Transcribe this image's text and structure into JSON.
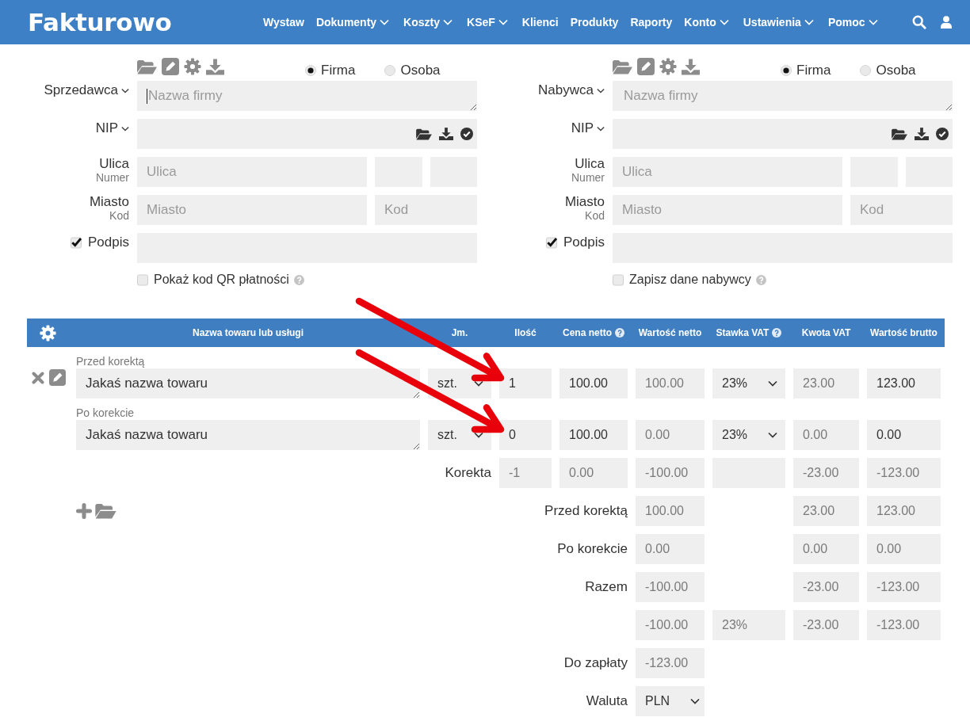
{
  "navbar": {
    "logo": "Fakturowo",
    "menu": [
      {
        "label": "Wystaw",
        "dropdown": false
      },
      {
        "label": "Dokumenty",
        "dropdown": true
      },
      {
        "label": "Koszty",
        "dropdown": true
      },
      {
        "label": "KSeF",
        "dropdown": true
      },
      {
        "label": "Klienci",
        "dropdown": false
      },
      {
        "label": "Produkty",
        "dropdown": false
      },
      {
        "label": "Raporty",
        "dropdown": false
      },
      {
        "label": "Konto",
        "dropdown": true
      },
      {
        "label": "Ustawienia",
        "dropdown": true
      },
      {
        "label": "Pomoc",
        "dropdown": true
      }
    ]
  },
  "parties": [
    {
      "label": "Sprzedawca",
      "entity_types": [
        {
          "label": "Firma",
          "selected": true
        },
        {
          "label": "Osoba",
          "selected": false
        }
      ],
      "name": {
        "placeholder": "Nazwa firmy",
        "focused": true
      },
      "nip_label": "NIP",
      "street": {
        "label": "Ulica",
        "sublabel": "Numer",
        "placeholder": "Ulica"
      },
      "city": {
        "label": "Miasto",
        "sublabel": "Kod",
        "placeholder": "Miasto",
        "code_placeholder": "Kod"
      },
      "signature": {
        "label": "Podpis",
        "checked": true
      },
      "option": {
        "label": "Pokaż kod QR płatności",
        "checked": false,
        "help": true
      }
    },
    {
      "label": "Nabywca",
      "entity_types": [
        {
          "label": "Firma",
          "selected": true
        },
        {
          "label": "Osoba",
          "selected": false
        }
      ],
      "name": {
        "placeholder": "Nazwa firmy",
        "focused": false
      },
      "nip_label": "NIP",
      "street": {
        "label": "Ulica",
        "sublabel": "Numer",
        "placeholder": "Ulica"
      },
      "city": {
        "label": "Miasto",
        "sublabel": "Kod",
        "placeholder": "Miasto",
        "code_placeholder": "Kod"
      },
      "signature": {
        "label": "Podpis",
        "checked": true
      },
      "option": {
        "label": "Zapisz dane nabywcy",
        "checked": false,
        "help": true
      }
    }
  ],
  "items_table": {
    "columns": [
      {
        "label": "Nazwa towaru lub usługi",
        "help": false
      },
      {
        "label": "Jm.",
        "help": false
      },
      {
        "label": "Ilość",
        "help": false
      },
      {
        "label": "Cena netto",
        "help": true
      },
      {
        "label": "Wartość netto",
        "help": false
      },
      {
        "label": "Stawka VAT",
        "help": true
      },
      {
        "label": "Kwota VAT",
        "help": false
      },
      {
        "label": "Wartość brutto",
        "help": false
      }
    ],
    "items": [
      {
        "rows": [
          {
            "kind": "line",
            "caption": "Przed korektą",
            "name": "Jakaś nazwa towaru",
            "cells": [
              {
                "kind": "select",
                "value": "szt."
              },
              {
                "kind": "input",
                "value": "1"
              },
              {
                "kind": "input",
                "value": "100.00"
              },
              {
                "kind": "readonly",
                "value": "100.00"
              },
              {
                "kind": "select",
                "value": "23%"
              },
              {
                "kind": "readonly",
                "value": "23.00"
              },
              {
                "kind": "input",
                "value": "123.00"
              }
            ]
          },
          {
            "kind": "line",
            "caption": "Po korekcie",
            "name": "Jakaś nazwa towaru",
            "cells": [
              {
                "kind": "select",
                "value": "szt."
              },
              {
                "kind": "input",
                "value": "0"
              },
              {
                "kind": "input",
                "value": "100.00"
              },
              {
                "kind": "readonly",
                "value": "0.00"
              },
              {
                "kind": "select",
                "value": "23%"
              },
              {
                "kind": "readonly",
                "value": "0.00"
              },
              {
                "kind": "input",
                "value": "0.00"
              }
            ]
          },
          {
            "kind": "difference",
            "cells": [
              {
                "kind": "label",
                "value": "Korekta"
              },
              {
                "kind": "readonly",
                "value": "-1"
              },
              {
                "kind": "readonly",
                "value": "0.00"
              },
              {
                "kind": "readonly",
                "value": "-100.00"
              },
              {
                "kind": "readonly"
              },
              {
                "kind": "readonly",
                "value": "-23.00"
              },
              {
                "kind": "readonly",
                "value": "-123.00"
              }
            ]
          }
        ]
      }
    ],
    "summary": [
      {
        "kind": "totals",
        "label": "Przed korektą",
        "net": "100.00",
        "vat": "23.00",
        "gross": "123.00"
      },
      {
        "kind": "totals",
        "label": "Po korekcie",
        "net": "0.00",
        "vat": "0.00",
        "gross": "0.00"
      },
      {
        "kind": "totals",
        "label": "Razem",
        "net": "-100.00",
        "vat": "-23.00",
        "gross": "-123.00"
      },
      {
        "kind": "totals",
        "net": "-100.00",
        "vat_rate": "23%",
        "vat": "-23.00",
        "gross": "-123.00"
      },
      {
        "kind": "due",
        "label": "Do zapłaty",
        "amount": "-123.00"
      },
      {
        "kind": "currency",
        "label": "Waluta",
        "value": "PLN"
      }
    ]
  },
  "annotations": [
    {
      "kind": "arrow"
    },
    {
      "kind": "arrow"
    }
  ]
}
